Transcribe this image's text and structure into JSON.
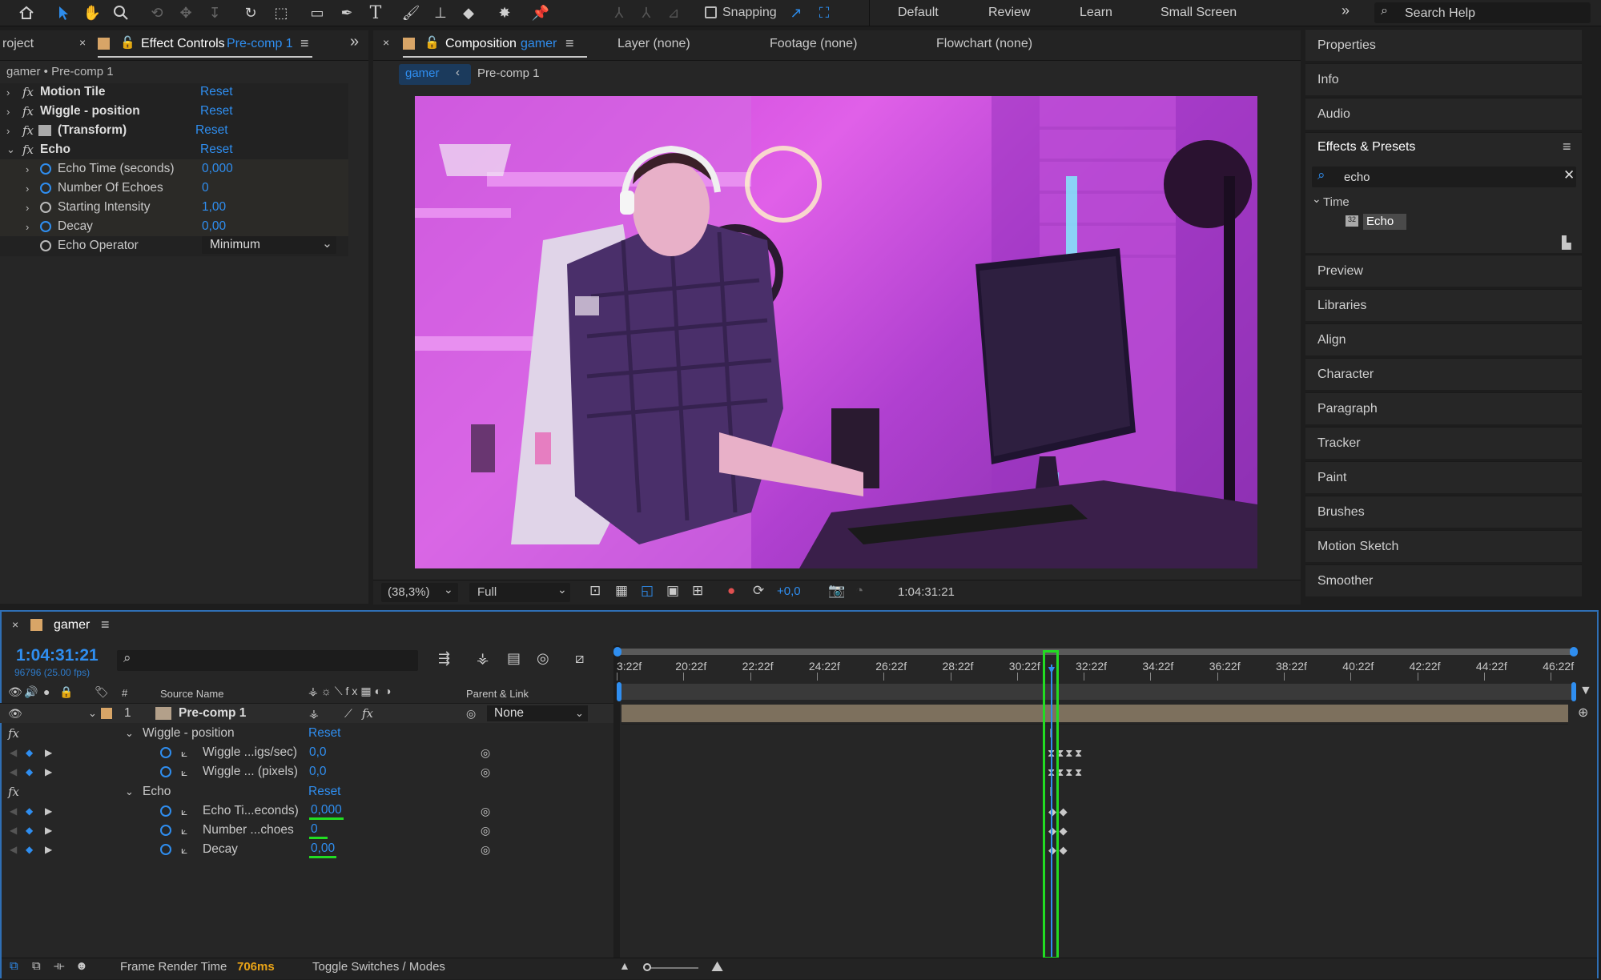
{
  "toolbar": {
    "snapping_label": "Snapping",
    "workspaces": [
      "Default",
      "Review",
      "Learn",
      "Small Screen"
    ],
    "search_placeholder": "Search Help",
    "tools": [
      "home-icon",
      "selection-tool-icon",
      "hand-tool-icon",
      "zoom-tool-icon",
      "orbit-camera-icon",
      "pan-camera-icon",
      "dolly-camera-icon",
      "rotate-tool-icon",
      "pan-behind-icon",
      "rectangle-tool-icon",
      "pen-tool-icon",
      "type-tool-icon",
      "brush-tool-icon",
      "clone-stamp-icon",
      "eraser-tool-icon",
      "roto-brush-icon",
      "puppet-pin-icon"
    ]
  },
  "left_panel": {
    "project_tab": "roject",
    "effect_controls_label": "Effect Controls",
    "effect_controls_comp": "Pre-comp 1",
    "layer_path": "gamer • Pre-comp 1",
    "effects": [
      {
        "name": "Motion Tile",
        "reset": "Reset"
      },
      {
        "name": "Wiggle - position",
        "reset": "Reset"
      },
      {
        "name": "(Transform)",
        "reset": "Reset"
      },
      {
        "name": "Echo",
        "reset": "Reset"
      }
    ],
    "echo_props": [
      {
        "name": "Echo Time (seconds)",
        "value": "0,000"
      },
      {
        "name": "Number Of Echoes",
        "value": "0"
      },
      {
        "name": "Starting Intensity",
        "value": "1,00"
      },
      {
        "name": "Decay",
        "value": "0,00"
      }
    ],
    "echo_operator": {
      "name": "Echo Operator",
      "value": "Minimum"
    }
  },
  "viewer": {
    "composition_label": "Composition",
    "composition_name": "gamer",
    "layer_tab": "Layer (none)",
    "footage_tab": "Footage (none)",
    "flowchart_tab": "Flowchart (none)",
    "breadcrumb_active": "gamer",
    "breadcrumb_next": "Pre-comp 1",
    "zoom": "(38,3%)",
    "resolution": "Full",
    "exposure": "+0,0",
    "timecode": "1:04:31:21"
  },
  "right_panel": {
    "items_top": [
      "Properties",
      "Info",
      "Audio"
    ],
    "effects_presets_title": "Effects & Presets",
    "search_value": "echo",
    "category": "Time",
    "result": "Echo",
    "items_bottom": [
      "Preview",
      "Libraries",
      "Align",
      "Character",
      "Paragraph",
      "Tracker",
      "Paint",
      "Brushes",
      "Motion Sketch",
      "Smoother"
    ]
  },
  "timeline": {
    "comp_tab": "gamer",
    "current_time": "1:04:31:21",
    "frame_info": "96796 (25.00 fps)",
    "col_num": "#",
    "col_source": "Source Name",
    "col_parent": "Parent & Link",
    "layer": {
      "index": "1",
      "name": "Pre-comp 1",
      "parent": "None"
    },
    "wiggle_group": {
      "name": "Wiggle - position",
      "reset": "Reset"
    },
    "wiggle_props": [
      {
        "name": "Wiggle ...igs/sec)",
        "value": "0,0"
      },
      {
        "name": "Wiggle ... (pixels)",
        "value": "0,0"
      }
    ],
    "echo_group": {
      "name": "Echo",
      "reset": "Reset"
    },
    "echo_props": [
      {
        "name": "Echo Ti...econds)",
        "value": "0,000"
      },
      {
        "name": "Number ...choes",
        "value": "0"
      },
      {
        "name": "Decay",
        "value": "0,00"
      }
    ],
    "ruler_ticks": [
      "3:22f",
      "20:22f",
      "22:22f",
      "24:22f",
      "26:22f",
      "28:22f",
      "30:22f",
      "32:22f",
      "34:22f",
      "36:22f",
      "38:22f",
      "40:22f",
      "42:22f",
      "44:22f",
      "46:22f"
    ],
    "footer_render_label": "Frame Render Time",
    "footer_render_value": "706ms",
    "footer_toggle": "Toggle Switches / Modes"
  },
  "colors": {
    "accent": "#2f8ef0",
    "highlight": "#22dd22",
    "render_time": "#e8a317"
  }
}
